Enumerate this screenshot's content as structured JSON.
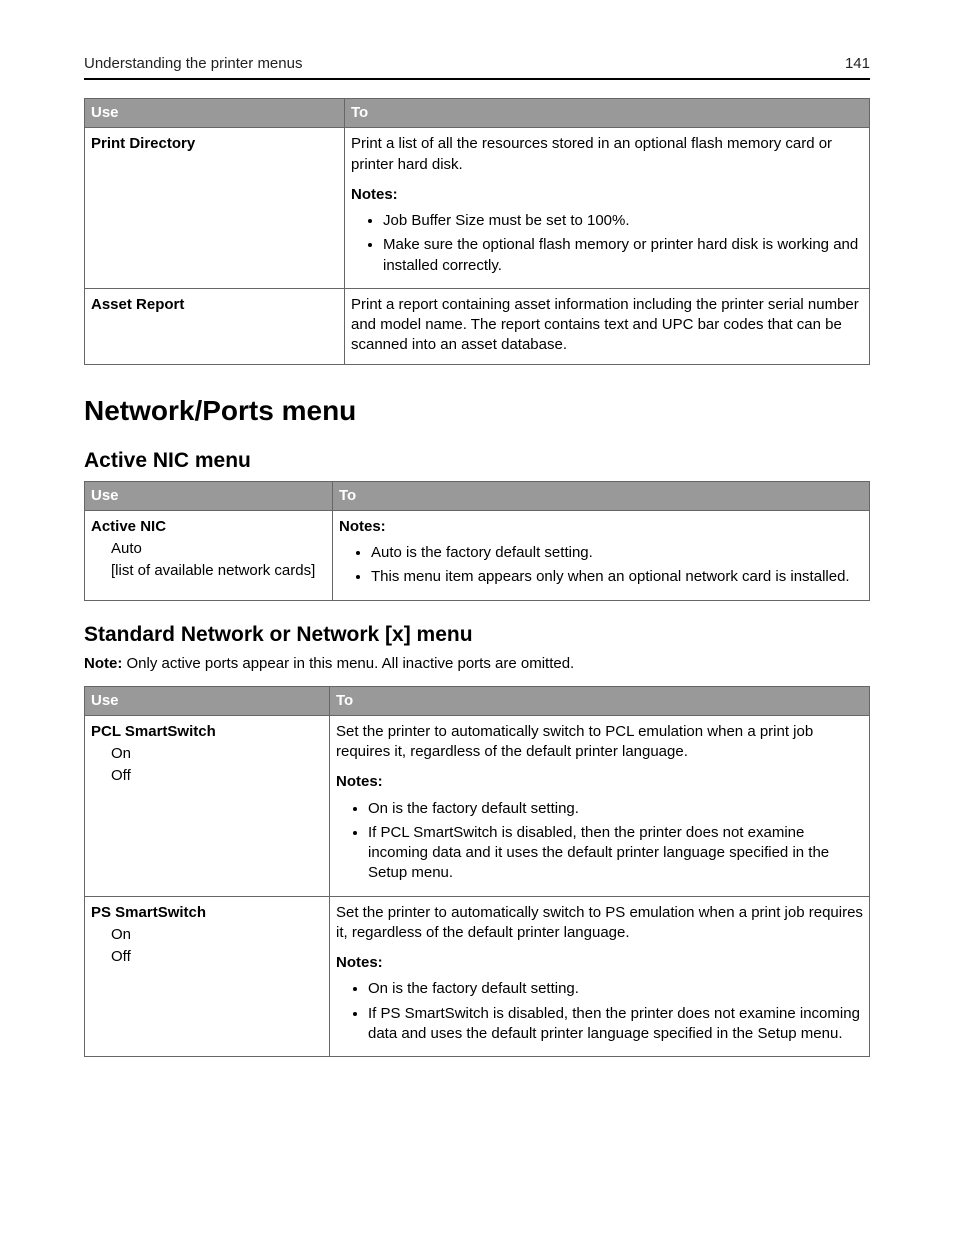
{
  "header": {
    "title": "Understanding the printer menus",
    "page": "141"
  },
  "table1": {
    "head": {
      "use": "Use",
      "to": "To"
    },
    "rows": [
      {
        "use_title": "Print Directory",
        "desc": "Print a list of all the resources stored in an optional flash memory card or printer hard disk.",
        "notes_label": "Notes:",
        "notes": [
          "Job Buffer Size must be set to 100%.",
          "Make sure the optional flash memory or printer hard disk is working and installed correctly."
        ]
      },
      {
        "use_title": "Asset Report",
        "desc": "Print a report containing asset information including the printer serial number and model name. The report contains text and UPC bar codes that can be scanned into an asset database."
      }
    ]
  },
  "section1": {
    "heading": "Network/Ports menu",
    "sub1": {
      "heading": "Active NIC menu",
      "table": {
        "head": {
          "use": "Use",
          "to": "To"
        },
        "row": {
          "use_title": "Active NIC",
          "use_sub1": "Auto",
          "use_sub2": "[list of available network cards]",
          "notes_label": "Notes:",
          "notes": [
            "Auto is the factory default setting.",
            "This menu item appears only when an optional network card is installed."
          ]
        }
      }
    },
    "sub2": {
      "heading": "Standard Network or Network [x] menu",
      "note_bold": "Note:",
      "note_text": " Only active ports appear in this menu. All inactive ports are omitted.",
      "table": {
        "head": {
          "use": "Use",
          "to": "To"
        },
        "rows": [
          {
            "use_title": "PCL SmartSwitch",
            "use_sub1": "On",
            "use_sub2": "Off",
            "desc": "Set the printer to automatically switch to PCL emulation when a print job requires it, regardless of the default printer language.",
            "notes_label": "Notes:",
            "notes": [
              "On is the factory default setting.",
              "If PCL SmartSwitch is disabled, then the printer does not examine incoming data and it uses the default printer language specified in the Setup menu."
            ]
          },
          {
            "use_title": "PS SmartSwitch",
            "use_sub1": "On",
            "use_sub2": "Off",
            "desc": "Set the printer to automatically switch to PS emulation when a print job requires it, regardless of the default printer language.",
            "notes_label": "Notes:",
            "notes": [
              "On is the factory default setting.",
              "If PS SmartSwitch is disabled, then the printer does not examine incoming data and uses the default printer language specified in the Setup menu."
            ]
          }
        ]
      }
    }
  }
}
